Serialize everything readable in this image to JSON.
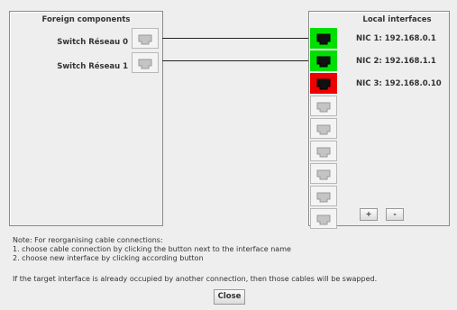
{
  "foreign": {
    "title": "Foreign components",
    "switches": [
      {
        "label": "Switch Réseau 0"
      },
      {
        "label": "Switch Réseau 1"
      }
    ]
  },
  "local": {
    "title": "Local interfaces",
    "nics": [
      {
        "label": "NIC 1: 192.168.0.1",
        "status": "connected",
        "color": "#00e000"
      },
      {
        "label": "NIC 2: 192.168.1.1",
        "status": "connected",
        "color": "#00e000"
      },
      {
        "label": "NIC 3: 192.168.0.10",
        "status": "unconnected",
        "color": "#ee0000"
      }
    ],
    "empty_slots": 6,
    "add_label": "+",
    "remove_label": "-"
  },
  "notes": {
    "line1": "Note: For reorganising cable connections:",
    "line2": "1. choose cable connection by clicking the button next to the interface name",
    "line3": "2. choose new interface by clicking according button",
    "line4": "If the target interface is already occupied by another connection, then those cables will be swapped."
  },
  "close_label": "Close",
  "colors": {
    "connected": "#00e000",
    "unconnected": "#ee0000",
    "panel_bg": "#eeeeee"
  }
}
